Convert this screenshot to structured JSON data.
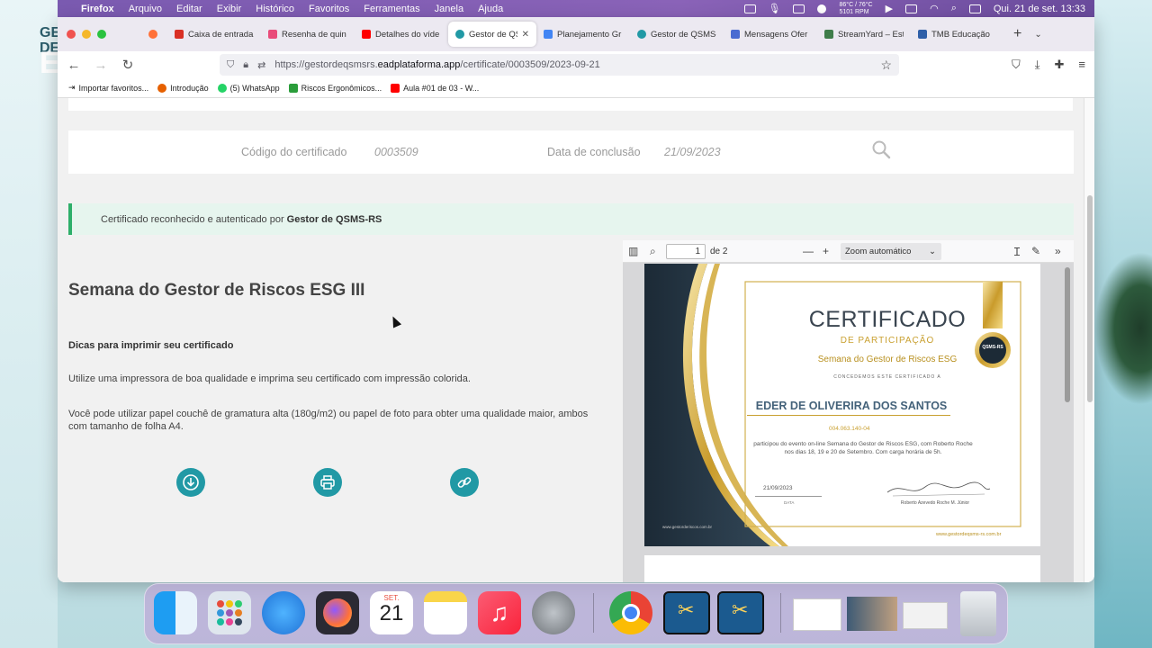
{
  "menubar": {
    "app": "Firefox",
    "items": [
      "Arquivo",
      "Editar",
      "Exibir",
      "Histórico",
      "Favoritos",
      "Ferramentas",
      "Janela",
      "Ajuda"
    ],
    "temp": "86°C / 76°C",
    "rpm": "5101 RPM",
    "datetime": "Qui. 21 de set.  13:33"
  },
  "desktop": {
    "left_text": "GE\nDE"
  },
  "tabs": [
    {
      "label": "Caixa de entrada",
      "color": "#d93025"
    },
    {
      "label": "Resenha de quin",
      "color": "#e94b7a"
    },
    {
      "label": "Detalhes do víde",
      "color": "#ff0000"
    },
    {
      "label": "Gestor de QSMS",
      "color": "#2199a5",
      "active": true
    },
    {
      "label": "Planejamento Gr",
      "color": "#4285f4"
    },
    {
      "label": "Gestor de QSMS-",
      "color": "#2199a5"
    },
    {
      "label": "Mensagens Ofer",
      "color": "#4a6bd1"
    },
    {
      "label": "StreamYard – Est",
      "color": "#3f7d4a"
    },
    {
      "label": "TMB Educação",
      "color": "#2f5fa8"
    }
  ],
  "url": {
    "prefix": "https://gestordeqsmsrs.",
    "domain": "eadplataforma.app",
    "path": "/certificate/0003509/2023-09-21"
  },
  "bookmarks": [
    {
      "label": "Importar favoritos...",
      "color": "#666"
    },
    {
      "label": "Introdução",
      "color": "#e66000"
    },
    {
      "label": "(5) WhatsApp",
      "color": "#25d366"
    },
    {
      "label": "Riscos Ergonômicos...",
      "color": "#2a9d3a"
    },
    {
      "label": "Aula #01 de 03 - W...",
      "color": "#ff0000"
    }
  ],
  "certificate_bar": {
    "code_label": "Código do certificado",
    "code_value": "0003509",
    "date_label": "Data de conclusão",
    "date_value": "21/09/2023"
  },
  "notice": {
    "text": "Certificado reconhecido e autenticado por",
    "org": "Gestor de QSMS-RS"
  },
  "course": {
    "title": "Semana do Gestor de Riscos ESG III",
    "tips_title": "Dicas para imprimir seu certificado",
    "tip1": "Utilize uma impressora de boa qualidade e imprima seu certificado com impressão colorida.",
    "tip2": "Você pode utilizar papel couchê de gramatura alta (180g/m2) ou papel de foto para obter uma qualidade maior, ambos com tamanho de folha A4."
  },
  "pdf": {
    "page": "1",
    "of": "de 2",
    "zoom": "Zoom automático",
    "cert_title": "CERTIFICADO",
    "cert_sub": "DE PARTICIPAÇÃO",
    "event": "Semana do Gestor de Riscos ESG",
    "granted": "CONCEDEMOS ESTE CERTIFICADO A",
    "name": "EDER DE OLIVERIRA DOS SANTOS",
    "doc": "004.063.140-04",
    "body": "participou do evento on-line Semana do Gestor de Riscos ESG, com Roberto Roche nos dias 18, 19 e 20 de Setembro. Com carga horária de 5h.",
    "date": "21/09/2023",
    "date_label": "DATA",
    "signer": "Roberto Azevedo Roche M. Júnior",
    "site_left": "www.gestorderiscos.com.br",
    "site_right": "www.gestordeqsms-rs.com.br",
    "seal": "QSMS-RS"
  },
  "dock": {
    "calendar_month": "SET.",
    "calendar_day": "21"
  }
}
